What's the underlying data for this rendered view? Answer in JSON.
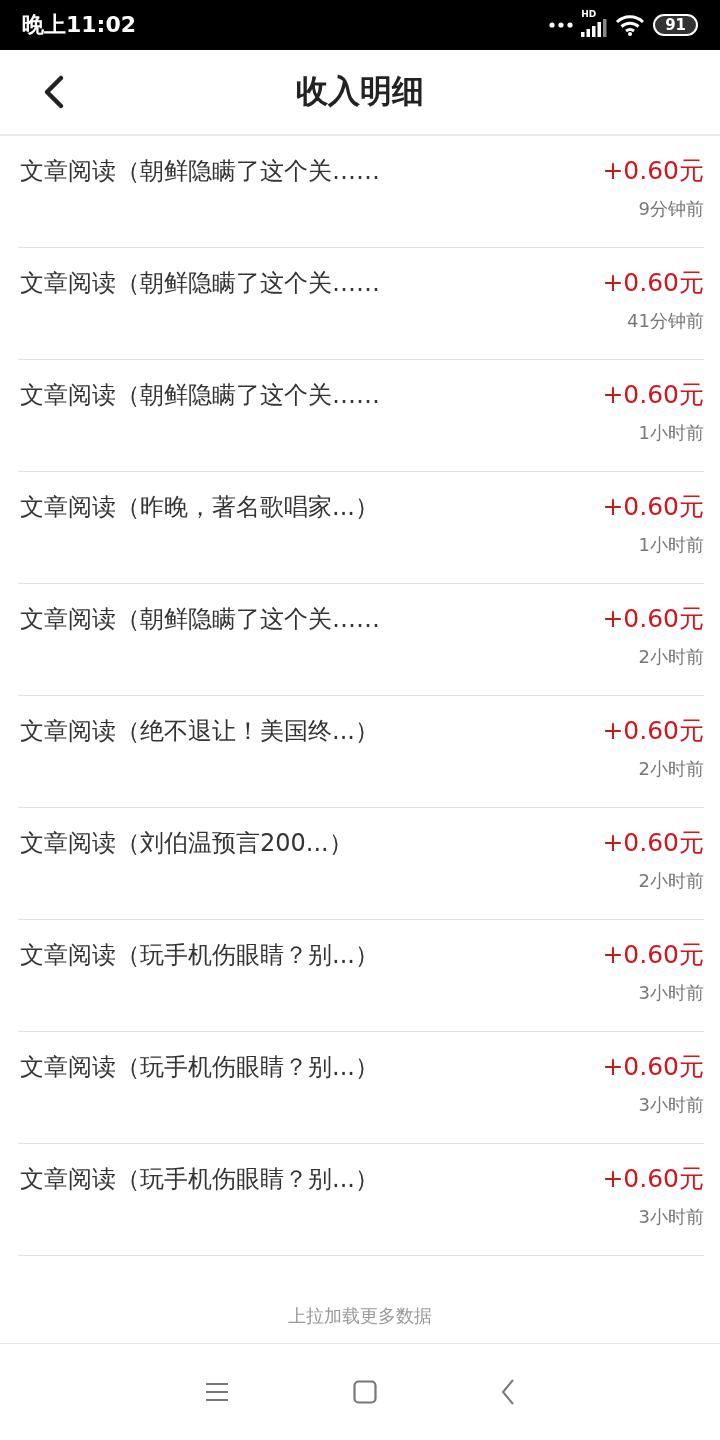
{
  "status_bar": {
    "time": "晚上11:02",
    "network_label": "HD",
    "battery": "91"
  },
  "header": {
    "title": "收入明细"
  },
  "records": [
    {
      "title": "文章阅读（朝鲜隐瞒了这个关……",
      "amount": "+0.60元",
      "time": "9分钟前"
    },
    {
      "title": "文章阅读（朝鲜隐瞒了这个关……",
      "amount": "+0.60元",
      "time": "41分钟前"
    },
    {
      "title": "文章阅读（朝鲜隐瞒了这个关……",
      "amount": "+0.60元",
      "time": "1小时前"
    },
    {
      "title": "文章阅读（昨晚，著名歌唱家...）",
      "amount": "+0.60元",
      "time": "1小时前"
    },
    {
      "title": "文章阅读（朝鲜隐瞒了这个关……",
      "amount": "+0.60元",
      "time": "2小时前"
    },
    {
      "title": "文章阅读（绝不退让！美国终...）",
      "amount": "+0.60元",
      "time": "2小时前"
    },
    {
      "title": "文章阅读（刘伯温预言200...）",
      "amount": "+0.60元",
      "time": "2小时前"
    },
    {
      "title": "文章阅读（玩手机伤眼睛？别...）",
      "amount": "+0.60元",
      "time": "3小时前"
    },
    {
      "title": "文章阅读（玩手机伤眼睛？别...）",
      "amount": "+0.60元",
      "time": "3小时前"
    },
    {
      "title": "文章阅读（玩手机伤眼睛？别...）",
      "amount": "+0.60元",
      "time": "3小时前"
    }
  ],
  "footer": {
    "hint": "上拉加载更多数据"
  }
}
